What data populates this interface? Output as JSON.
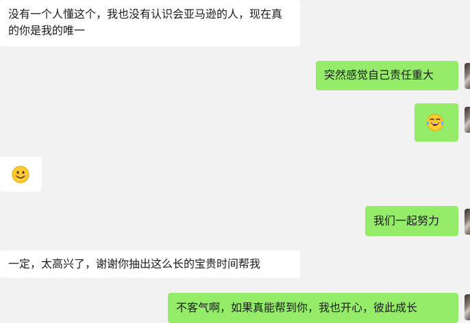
{
  "messages": [
    {
      "side": "received",
      "text": "没有一个人懂这个，我也没有认识会亚马逊的人，现在真的你是我的唯一"
    },
    {
      "side": "sent",
      "text": "突然感觉自己责任重大"
    },
    {
      "side": "sent",
      "emoji": "laughing-tears-emoji"
    },
    {
      "side": "received",
      "emoji": "smile-emoji"
    },
    {
      "side": "sent",
      "text": "我们一起努力"
    },
    {
      "side": "received",
      "text": "一定，太高兴了，谢谢你抽出这么长的宝贵时间帮我"
    },
    {
      "side": "sent",
      "text": "不客气啊，如果真能帮到你，我也开心，彼此成长"
    }
  ],
  "colors": {
    "background": "#f2f2f2",
    "received_bubble": "#ffffff",
    "sent_bubble": "#95ec69",
    "text": "#1a1a1a"
  }
}
